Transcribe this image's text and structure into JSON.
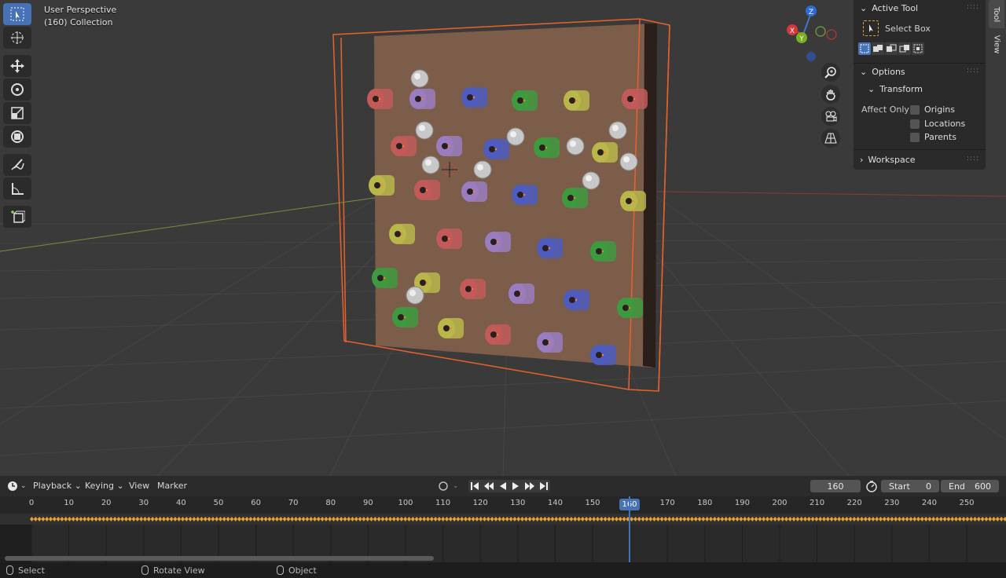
{
  "viewport": {
    "view_name": "User Perspective",
    "collection_label": "(160) Collection",
    "axis_labels": {
      "z": "Z",
      "y": "Y",
      "x": "X"
    }
  },
  "toolbar": {
    "tools": [
      "select-box",
      "cursor",
      "move",
      "rotate",
      "scale",
      "transform",
      "annotate",
      "measure",
      "add-cube"
    ]
  },
  "npanel": {
    "active_tool_header": "Active Tool",
    "active_tool_name": "Select Box",
    "options_header": "Options",
    "transform_header": "Transform",
    "affect_only_label": "Affect Only",
    "affect_options": [
      "Origins",
      "Locations",
      "Parents"
    ],
    "workspace_header": "Workspace",
    "tabs": [
      "Tool",
      "View"
    ]
  },
  "timeline": {
    "menus": [
      "Playback",
      "Keying",
      "View",
      "Marker"
    ],
    "current_frame": "160",
    "start_label": "Start",
    "start_value": "0",
    "end_label": "End",
    "end_value": "600",
    "ticks": [
      "0",
      "10",
      "20",
      "30",
      "40",
      "50",
      "60",
      "70",
      "80",
      "90",
      "100",
      "110",
      "120",
      "130",
      "140",
      "150",
      "160",
      "170",
      "180",
      "190",
      "200",
      "210",
      "220",
      "230",
      "240",
      "250"
    ]
  },
  "statusbar": {
    "items": [
      "Select",
      "Rotate View",
      "Object"
    ]
  },
  "colors": {
    "accent": "#4772b3",
    "selection_outline": "#e8622c",
    "keyframe": "#e8a234"
  }
}
